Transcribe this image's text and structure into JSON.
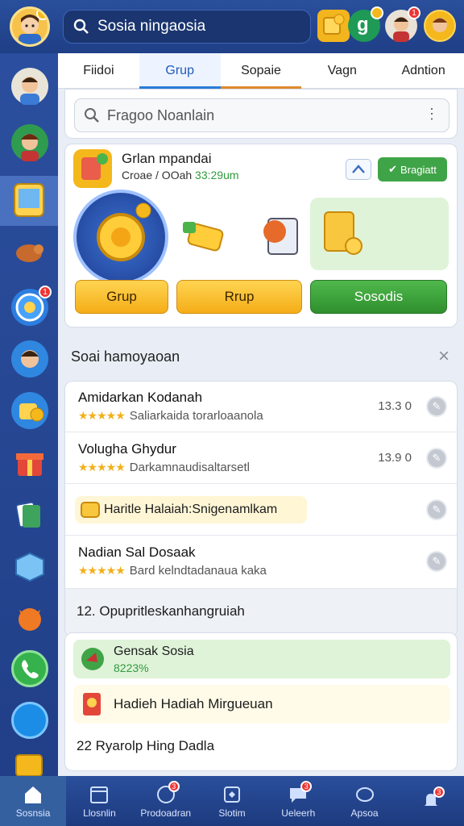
{
  "header": {
    "search_text": "Sosia ningaosia"
  },
  "tabs": [
    {
      "label": "Fiidoi"
    },
    {
      "label": "Grup"
    },
    {
      "label": "Sopaie"
    },
    {
      "label": "Vagn"
    },
    {
      "label": "Adntion"
    }
  ],
  "subsearch": {
    "placeholder": "Fragoo Noanlain"
  },
  "group_card": {
    "title": "Grlan mpandai",
    "subtitle": "Croae / OOah",
    "subtitle_highlight": "33:29um",
    "badge_label": "Bragiatt",
    "buttons": [
      "Grup",
      "Rrup",
      "Sosodis"
    ]
  },
  "section_header": {
    "title": "Soai hamoyaoan"
  },
  "list_items": [
    {
      "title": "Amidarkan Kodanah",
      "sub": "Saliarkaida torarloaanola",
      "value": "13.3 0",
      "stars": "★★★★★"
    },
    {
      "title": "Volugha Ghydur",
      "sub": "Darkamnaudisaltarsetl",
      "value": "13.9 0",
      "stars": "★★★★★"
    },
    {
      "title": "Haritle Halaiah:Snigenamlkam",
      "sub": "",
      "value": "",
      "stars": ""
    },
    {
      "title": "Nadian Sal Dosaak",
      "sub": "Bard kelndtadanaua kaka",
      "value": "",
      "stars": "★★★★★"
    }
  ],
  "count_line": "12. Opupritleskanhangruiah",
  "bottom_list": [
    {
      "title": "Gensak Sosia",
      "sub": "8223%"
    },
    {
      "title": "Hadieh Hadiah Mirgueuan",
      "sub": ""
    },
    {
      "title": "22 Ryarolp Hing Dadla",
      "sub": ""
    }
  ],
  "bottom_nav": [
    {
      "label": "Sosnsia"
    },
    {
      "label": "Llosnlin"
    },
    {
      "label": "Prodoadran"
    },
    {
      "label": "Slotim"
    },
    {
      "label": "Ueleerh"
    },
    {
      "label": "Apsoa"
    }
  ],
  "badges": {
    "top_green": "g",
    "notif": "1",
    "nav_badge": "3"
  }
}
